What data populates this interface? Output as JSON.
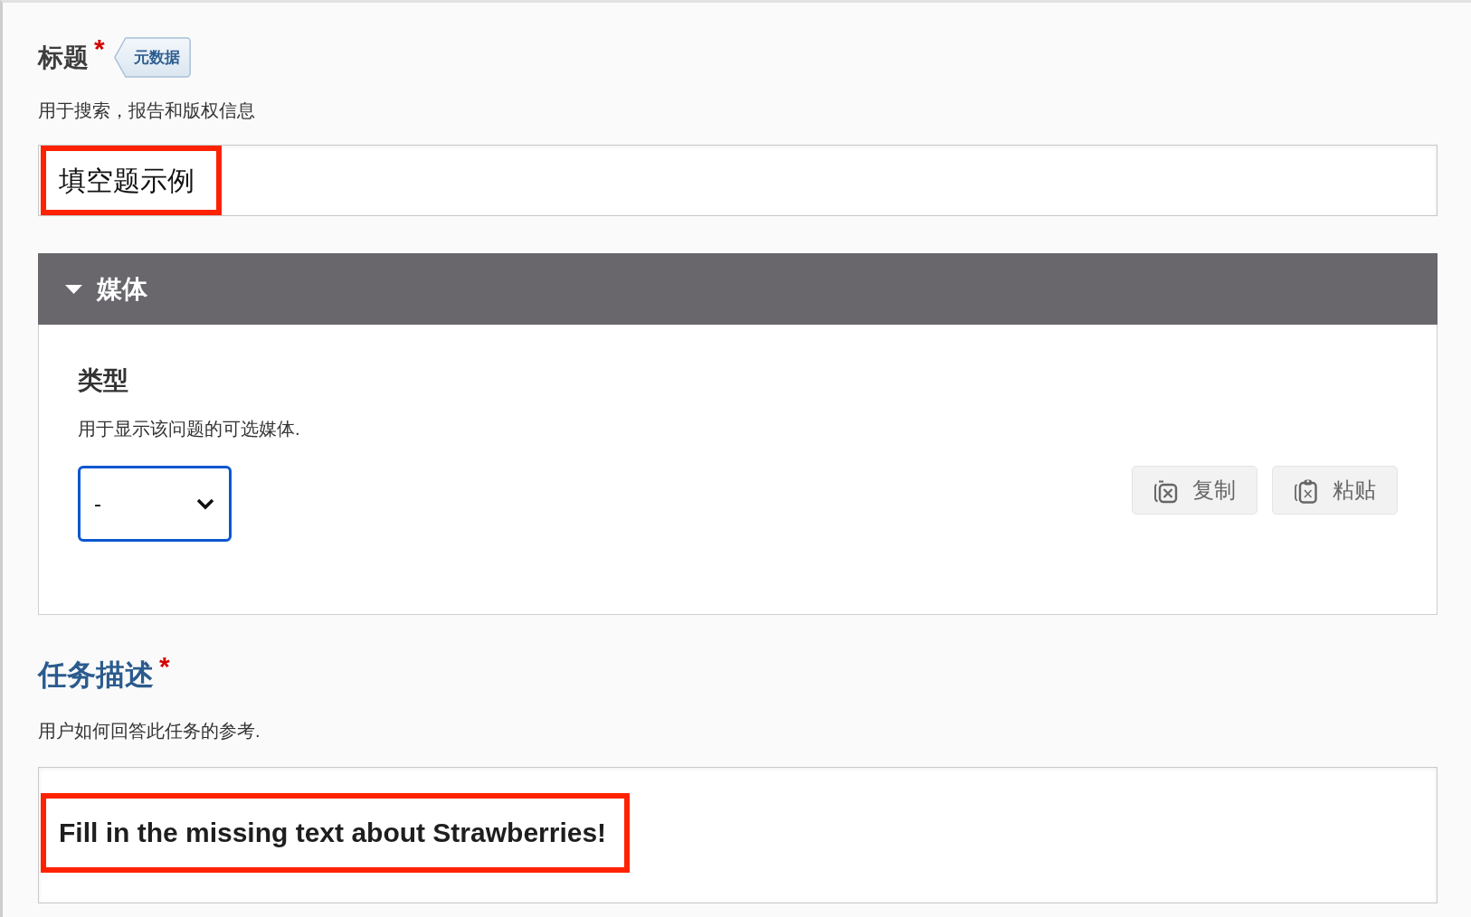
{
  "title_field": {
    "label": "标题",
    "required_mark": "*",
    "badge": "元数据",
    "help": "用于搜索，报告和版权信息",
    "value": "填空题示例",
    "highlighted": true
  },
  "media_section": {
    "title": "媒体",
    "expanded": true,
    "type_label": "类型",
    "type_help": "用于显示该问题的可选媒体.",
    "select": {
      "value": "-",
      "focused": true
    },
    "buttons": [
      {
        "label": "复制",
        "kind": "copy"
      },
      {
        "label": "粘贴",
        "kind": "paste"
      }
    ]
  },
  "task_field": {
    "label": "任务描述",
    "required_mark": "*",
    "help": "用户如何回答此任务的参考.",
    "value": "Fill in the missing text about Strawberries!",
    "highlighted": true
  }
}
